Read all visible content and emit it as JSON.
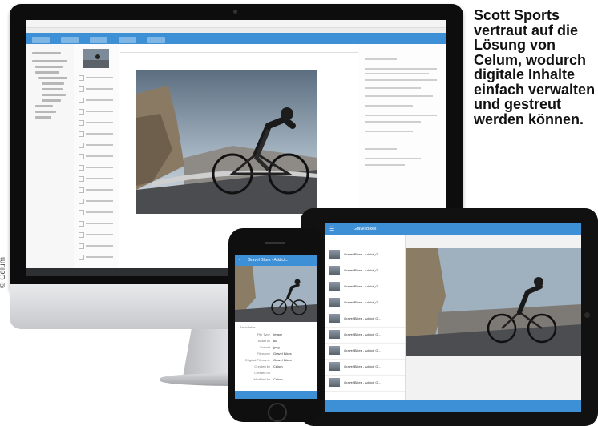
{
  "tagline": "Scott Sports\nvertraut auf die\nLösung von\nCelum, wodurch\ndigitale Inhalte\neinfach verwalten\nund gestreut\nwerden können.",
  "credit": "© Celum",
  "colors": {
    "accent": "#3d8fd6",
    "dark_bar": "#2d2f33"
  },
  "tablet": {
    "header_title": "Gravel Bikes",
    "list_items": [
      "Gravel Bikes - Addict_G...",
      "Gravel Bikes - Addict_G...",
      "Gravel Bikes - Addict_G...",
      "Gravel Bikes - Addict_G...",
      "Gravel Bikes - Addict_G...",
      "Gravel Bikes - Addict_G...",
      "Gravel Bikes - Addict_G...",
      "Gravel Bikes - Addict_G...",
      "Gravel Bikes - Addict_G..."
    ]
  },
  "phone": {
    "header_title": "Gravel Bikes - Addict...",
    "section_label": "Basic Infos",
    "fields": [
      {
        "key": "File Type",
        "value": "Image"
      },
      {
        "key": "Asset ID",
        "value": "86"
      },
      {
        "key": "Format",
        "value": "jpeg"
      },
      {
        "key": "Filename",
        "value": "Gravel Bikes"
      },
      {
        "key": "Original Filename",
        "value": "Gravel Bikes"
      },
      {
        "key": "Created by",
        "value": "Celum"
      },
      {
        "key": "Created on",
        "value": ""
      },
      {
        "key": "Modified by",
        "value": "Celum"
      }
    ]
  },
  "photo_icon": "road-cyclist-photo"
}
